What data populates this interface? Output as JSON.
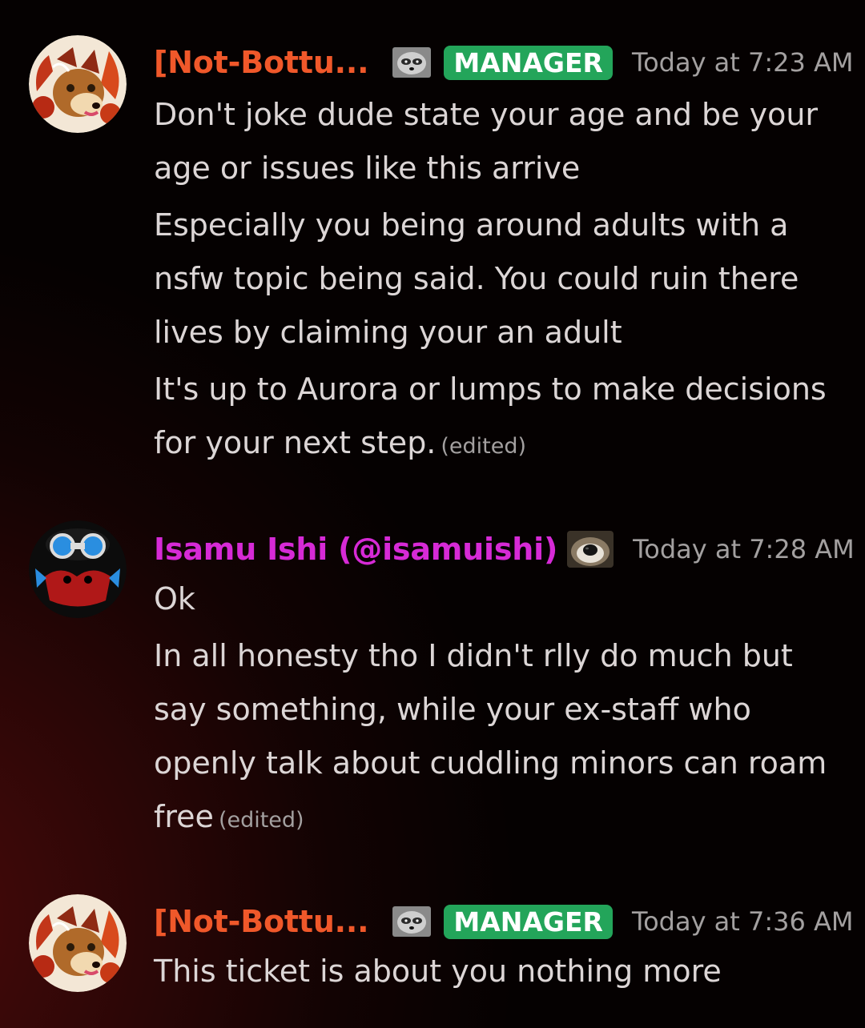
{
  "messages": [
    {
      "author": "[Not-Bottu...",
      "author_color": "#f0582a",
      "role_icon": "raccoon-emoji-icon",
      "badge": "MANAGER",
      "badge_color": "#23a55a",
      "timestamp": "Today at 7:23 AM",
      "paragraphs": [
        {
          "text": "Don't joke dude state your age and be your age or issues like this arrive",
          "edited": ""
        },
        {
          "text": "Especially you being around adults with a nsfw topic being said. You could ruin there lives by claiming your an adult",
          "edited": ""
        },
        {
          "text": "It's up to Aurora or lumps to make decisions for your next step.",
          "edited": "(edited)"
        }
      ]
    },
    {
      "author": "Isamu Ishi (@isamuishi)",
      "author_color": "#d62ad6",
      "role_icon": "dog-nose-emoji-icon",
      "timestamp": "Today at 7:28 AM",
      "paragraphs": [
        {
          "text": "Ok",
          "edited": ""
        },
        {
          "text": "In all honesty tho I didn't rlly do much but say something, while your ex-staff who openly talk about cuddling minors can roam free",
          "edited": "(edited)"
        }
      ]
    },
    {
      "author": "[Not-Bottu...",
      "author_color": "#f0582a",
      "role_icon": "raccoon-emoji-icon",
      "badge": "MANAGER",
      "badge_color": "#23a55a",
      "timestamp": "Today at 7:36 AM",
      "paragraphs": [
        {
          "text": "This ticket is about you nothing more",
          "edited": ""
        }
      ]
    }
  ]
}
